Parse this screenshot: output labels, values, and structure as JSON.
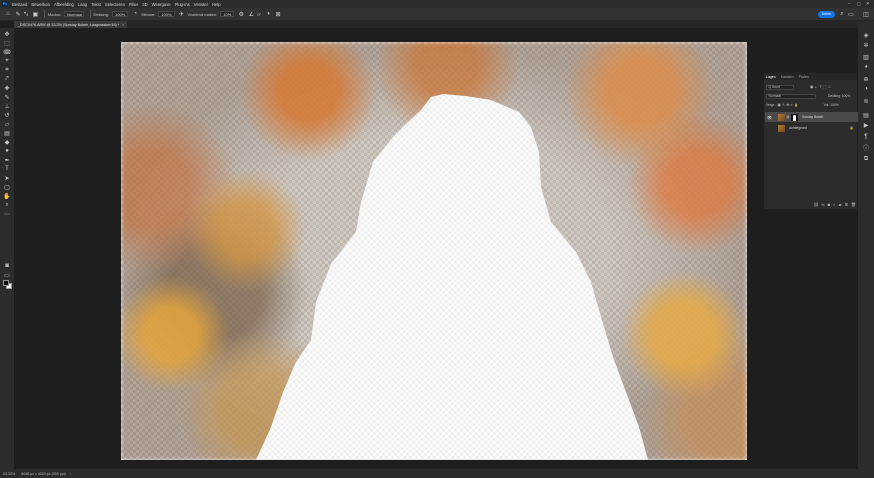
{
  "app": {
    "name": "Ps"
  },
  "menu": [
    "Bestand",
    "Bewerken",
    "Afbeelding",
    "Laag",
    "Tekst",
    "Selecteren",
    "Filter",
    "3D",
    "Weergave",
    "Plug-ins",
    "Venster",
    "Help"
  ],
  "window_controls": [
    "–",
    "▢",
    "✕"
  ],
  "options_bar": {
    "brush_size": "4",
    "mode_label": "Modus:",
    "mode_value": "Normaal",
    "opacity_label": "Dekking:",
    "opacity_value": "100%",
    "flow_label": "Stroom:",
    "flow_value": "100%",
    "smoothing_label": "Vloeiend maken:",
    "smoothing_value": "10%",
    "angle_value": "0°",
    "share_label": "Delen"
  },
  "document_tab": {
    "title": "_DSC0476.ARW @ 33,3% (Sunday Bokeh, Laagmasker/16) *",
    "close": "×"
  },
  "layers_panel": {
    "tabs": [
      "Lagen",
      "Kanalen",
      "Paden"
    ],
    "active_tab": "Lagen",
    "filter_label": "Q Soort",
    "blend_mode": "Normaal",
    "opacity_label": "Dekking:",
    "opacity_value": "100%",
    "lock_label": "Vergr.:",
    "fill_label": "Vul:",
    "fill_value": "100%",
    "layers": [
      {
        "name": "Sunday Bokeh",
        "selected": true,
        "has_mask": true
      },
      {
        "name": "Achtergrond",
        "selected": false,
        "has_mask": false
      }
    ]
  },
  "status_bar": {
    "zoom": "33,33%",
    "doc_info": "6048 px x 4024 px (300 ppi)"
  },
  "colors": {
    "accent": "#1473e6",
    "panel_bg": "#2c2c2c",
    "canvas_bg": "#1e1e1e",
    "foreground_swatch": "#000000",
    "background_swatch": "#ffffff"
  },
  "tools": [
    "move-icon",
    "marquee-icon",
    "lasso-icon",
    "quick-select-icon",
    "crop-icon",
    "eyedropper-icon",
    "healing-icon",
    "brush-icon",
    "stamp-icon",
    "history-brush-icon",
    "eraser-icon",
    "gradient-icon",
    "blur-icon",
    "dodge-icon",
    "pen-icon",
    "type-icon",
    "path-select-icon",
    "shape-icon",
    "hand-icon",
    "zoom-icon",
    "more-icon"
  ]
}
